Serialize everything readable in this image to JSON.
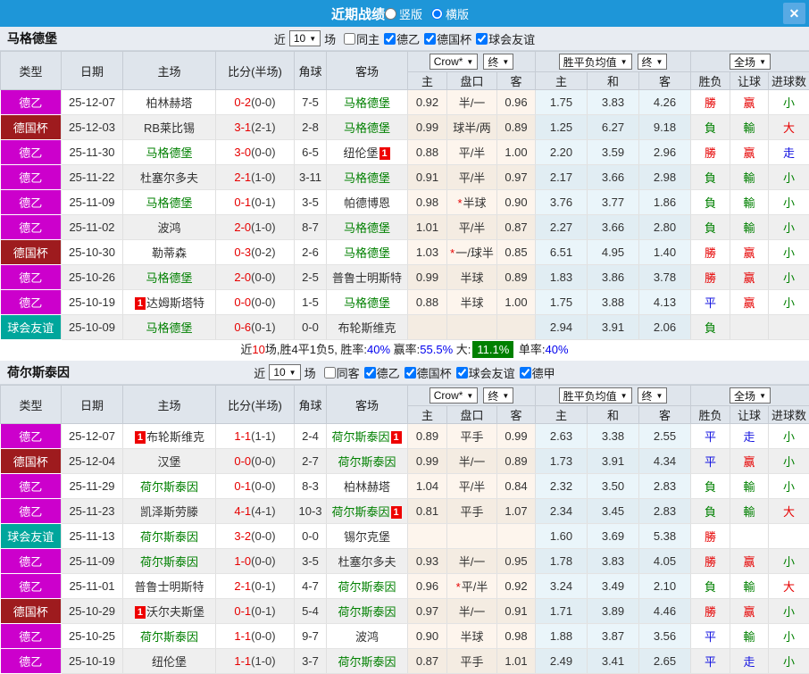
{
  "titlebar": {
    "title": "近期战绩",
    "layout_options": [
      {
        "label": "竖版",
        "checked": false
      },
      {
        "label": "横版",
        "checked": true
      }
    ]
  },
  "icons": {
    "dropdown_arrow": "▼",
    "close": "✕"
  },
  "palette": {
    "titlebar_blue": "#1e96d8",
    "league2_magenta": "#cc00cc",
    "cup_darkred": "#9e1b1e",
    "friendly_teal": "#00a69c",
    "team_green": "#008000",
    "win_red": "#e60000",
    "draw_blue": "#1313e0",
    "rate_blue": "#0000ee",
    "big_rate_badge_bg": "#008000"
  },
  "table_header": {
    "columns": [
      "类型",
      "日期",
      "主场",
      "比分(半场)",
      "角球",
      "客场"
    ],
    "sub_columns": [
      "主",
      "盘口",
      "客",
      "主",
      "和",
      "客",
      "胜负",
      "让球",
      "进球数"
    ],
    "dropdowns": {
      "odds_source": "Crow*",
      "odds_stage": "终",
      "avg_source": "胜平负均值",
      "avg_stage": "终",
      "scope": "全场"
    }
  },
  "sections": [
    {
      "team": "马格德堡",
      "filter": {
        "near_label": "近",
        "count": "10",
        "unit_label": "场",
        "checkboxes": [
          {
            "label": "同主",
            "checked": false
          },
          {
            "label": "德乙",
            "checked": true
          },
          {
            "label": "德国杯",
            "checked": true
          },
          {
            "label": "球会友谊",
            "checked": true
          }
        ]
      },
      "rows": [
        {
          "type": "德乙",
          "style": "lg2",
          "date": "25-12-07",
          "home": "柏林赫塔",
          "home_green": false,
          "home_badge": "",
          "score": "0-2",
          "half": "(0-0)",
          "corner": "7-5",
          "away": "马格德堡",
          "away_green": true,
          "away_badge": "",
          "o1": "0.92",
          "hcp": "半/一",
          "star": false,
          "o2": "0.96",
          "a1": "1.75",
          "a2": "3.83",
          "a3": "4.26",
          "res": "勝",
          "res_c": "r",
          "hres": "赢",
          "hres_c": "r",
          "goal": "小",
          "goal_c": "g"
        },
        {
          "type": "德国杯",
          "style": "cup",
          "date": "25-12-03",
          "home": "RB莱比锡",
          "home_green": false,
          "home_badge": "",
          "score": "3-1",
          "half": "(2-1)",
          "corner": "2-8",
          "away": "马格德堡",
          "away_green": true,
          "away_badge": "",
          "o1": "0.99",
          "hcp": "球半/两",
          "star": false,
          "o2": "0.89",
          "a1": "1.25",
          "a2": "6.27",
          "a3": "9.18",
          "res": "負",
          "res_c": "g",
          "hres": "輸",
          "hres_c": "g",
          "goal": "大",
          "goal_c": "r"
        },
        {
          "type": "德乙",
          "style": "lg2",
          "date": "25-11-30",
          "home": "马格德堡",
          "home_green": true,
          "home_badge": "",
          "score": "3-0",
          "half": "(0-0)",
          "corner": "6-5",
          "away": "纽伦堡",
          "away_green": false,
          "away_badge": "1",
          "o1": "0.88",
          "hcp": "平/半",
          "star": false,
          "o2": "1.00",
          "a1": "2.20",
          "a2": "3.59",
          "a3": "2.96",
          "res": "勝",
          "res_c": "r",
          "hres": "赢",
          "hres_c": "r",
          "goal": "走",
          "goal_c": "b"
        },
        {
          "type": "德乙",
          "style": "lg2",
          "date": "25-11-22",
          "home": "杜塞尔多夫",
          "home_green": false,
          "home_badge": "",
          "score": "2-1",
          "half": "(1-0)",
          "corner": "3-11",
          "away": "马格德堡",
          "away_green": true,
          "away_badge": "",
          "o1": "0.91",
          "hcp": "平/半",
          "star": false,
          "o2": "0.97",
          "a1": "2.17",
          "a2": "3.66",
          "a3": "2.98",
          "res": "負",
          "res_c": "g",
          "hres": "輸",
          "hres_c": "g",
          "goal": "小",
          "goal_c": "g"
        },
        {
          "type": "德乙",
          "style": "lg2",
          "date": "25-11-09",
          "home": "马格德堡",
          "home_green": true,
          "home_badge": "",
          "score": "0-1",
          "half": "(0-1)",
          "corner": "3-5",
          "away": "帕德博恩",
          "away_green": false,
          "away_badge": "",
          "o1": "0.98",
          "hcp": "半球",
          "star": true,
          "o2": "0.90",
          "a1": "3.76",
          "a2": "3.77",
          "a3": "1.86",
          "res": "負",
          "res_c": "g",
          "hres": "輸",
          "hres_c": "g",
          "goal": "小",
          "goal_c": "g"
        },
        {
          "type": "德乙",
          "style": "lg2",
          "date": "25-11-02",
          "home": "波鸿",
          "home_green": false,
          "home_badge": "",
          "score": "2-0",
          "half": "(1-0)",
          "corner": "8-7",
          "away": "马格德堡",
          "away_green": true,
          "away_badge": "",
          "o1": "1.01",
          "hcp": "平/半",
          "star": false,
          "o2": "0.87",
          "a1": "2.27",
          "a2": "3.66",
          "a3": "2.80",
          "res": "負",
          "res_c": "g",
          "hres": "輸",
          "hres_c": "g",
          "goal": "小",
          "goal_c": "g"
        },
        {
          "type": "德国杯",
          "style": "cup",
          "date": "25-10-30",
          "home": "勒蒂森",
          "home_green": false,
          "home_badge": "",
          "score": "0-3",
          "half": "(0-2)",
          "corner": "2-6",
          "away": "马格德堡",
          "away_green": true,
          "away_badge": "",
          "o1": "1.03",
          "hcp": "一/球半",
          "star": true,
          "o2": "0.85",
          "a1": "6.51",
          "a2": "4.95",
          "a3": "1.40",
          "res": "勝",
          "res_c": "r",
          "hres": "赢",
          "hres_c": "r",
          "goal": "小",
          "goal_c": "g"
        },
        {
          "type": "德乙",
          "style": "lg2",
          "date": "25-10-26",
          "home": "马格德堡",
          "home_green": true,
          "home_badge": "",
          "score": "2-0",
          "half": "(0-0)",
          "corner": "2-5",
          "away": "普鲁士明斯特",
          "away_green": false,
          "away_badge": "",
          "o1": "0.99",
          "hcp": "半球",
          "star": false,
          "o2": "0.89",
          "a1": "1.83",
          "a2": "3.86",
          "a3": "3.78",
          "res": "勝",
          "res_c": "r",
          "hres": "赢",
          "hres_c": "r",
          "goal": "小",
          "goal_c": "g"
        },
        {
          "type": "德乙",
          "style": "lg2",
          "date": "25-10-19",
          "home": "达姆斯塔特",
          "home_green": false,
          "home_badge": "1",
          "score": "0-0",
          "half": "(0-0)",
          "corner": "1-5",
          "away": "马格德堡",
          "away_green": true,
          "away_badge": "",
          "o1": "0.88",
          "hcp": "半球",
          "star": false,
          "o2": "1.00",
          "a1": "1.75",
          "a2": "3.88",
          "a3": "4.13",
          "res": "平",
          "res_c": "b",
          "hres": "赢",
          "hres_c": "r",
          "goal": "小",
          "goal_c": "g"
        },
        {
          "type": "球会友谊",
          "style": "fri",
          "date": "25-10-09",
          "home": "马格德堡",
          "home_green": true,
          "home_badge": "",
          "score": "0-6",
          "half": "(0-1)",
          "corner": "0-0",
          "away": "布轮斯维克",
          "away_green": false,
          "away_badge": "",
          "o1": "",
          "hcp": "",
          "star": false,
          "o2": "",
          "a1": "2.94",
          "a2": "3.91",
          "a3": "2.06",
          "res": "負",
          "res_c": "g",
          "hres": "",
          "hres_c": "",
          "goal": "",
          "goal_c": ""
        }
      ],
      "summary": [
        {
          "t": "近"
        },
        {
          "t": "10",
          "c": "red"
        },
        {
          "t": "场,胜4平1负5, 胜率:"
        },
        {
          "t": "40%",
          "c": "blue"
        },
        {
          "t": " 赢率:"
        },
        {
          "t": "55.5%",
          "c": "blue"
        },
        {
          "t": " 大:"
        },
        {
          "t": "11.1%",
          "c": "badge"
        },
        {
          "t": " 单率:"
        },
        {
          "t": "40%",
          "c": "blue"
        }
      ]
    },
    {
      "team": "荷尔斯泰因",
      "filter": {
        "near_label": "近",
        "count": "10",
        "unit_label": "场",
        "checkboxes": [
          {
            "label": "同客",
            "checked": false
          },
          {
            "label": "德乙",
            "checked": true
          },
          {
            "label": "德国杯",
            "checked": true
          },
          {
            "label": "球会友谊",
            "checked": true
          },
          {
            "label": "德甲",
            "checked": true
          }
        ]
      },
      "rows": [
        {
          "type": "德乙",
          "style": "lg2",
          "date": "25-12-07",
          "home": "布轮斯维克",
          "home_green": false,
          "home_badge": "1",
          "score": "1-1",
          "half": "(1-1)",
          "corner": "2-4",
          "away": "荷尔斯泰因",
          "away_green": true,
          "away_badge": "1",
          "o1": "0.89",
          "hcp": "平手",
          "star": false,
          "o2": "0.99",
          "a1": "2.63",
          "a2": "3.38",
          "a3": "2.55",
          "res": "平",
          "res_c": "b",
          "hres": "走",
          "hres_c": "b",
          "goal": "小",
          "goal_c": "g"
        },
        {
          "type": "德国杯",
          "style": "cup",
          "date": "25-12-04",
          "home": "汉堡",
          "home_green": false,
          "home_badge": "",
          "score": "0-0",
          "half": "(0-0)",
          "corner": "2-7",
          "away": "荷尔斯泰因",
          "away_green": true,
          "away_badge": "",
          "o1": "0.99",
          "hcp": "半/一",
          "star": false,
          "o2": "0.89",
          "a1": "1.73",
          "a2": "3.91",
          "a3": "4.34",
          "res": "平",
          "res_c": "b",
          "hres": "赢",
          "hres_c": "r",
          "goal": "小",
          "goal_c": "g"
        },
        {
          "type": "德乙",
          "style": "lg2",
          "date": "25-11-29",
          "home": "荷尔斯泰因",
          "home_green": true,
          "home_badge": "",
          "score": "0-1",
          "half": "(0-0)",
          "corner": "8-3",
          "away": "柏林赫塔",
          "away_green": false,
          "away_badge": "",
          "o1": "1.04",
          "hcp": "平/半",
          "star": false,
          "o2": "0.84",
          "a1": "2.32",
          "a2": "3.50",
          "a3": "2.83",
          "res": "負",
          "res_c": "g",
          "hres": "輸",
          "hres_c": "g",
          "goal": "小",
          "goal_c": "g"
        },
        {
          "type": "德乙",
          "style": "lg2",
          "date": "25-11-23",
          "home": "凯泽斯劳滕",
          "home_green": false,
          "home_badge": "",
          "score": "4-1",
          "half": "(4-1)",
          "corner": "10-3",
          "away": "荷尔斯泰因",
          "away_green": true,
          "away_badge": "1",
          "o1": "0.81",
          "hcp": "平手",
          "star": false,
          "o2": "1.07",
          "a1": "2.34",
          "a2": "3.45",
          "a3": "2.83",
          "res": "負",
          "res_c": "g",
          "hres": "輸",
          "hres_c": "g",
          "goal": "大",
          "goal_c": "r"
        },
        {
          "type": "球会友谊",
          "style": "fri",
          "date": "25-11-13",
          "home": "荷尔斯泰因",
          "home_green": true,
          "home_badge": "",
          "score": "3-2",
          "half": "(0-0)",
          "corner": "0-0",
          "away": "锡尔克堡",
          "away_green": false,
          "away_badge": "",
          "o1": "",
          "hcp": "",
          "star": false,
          "o2": "",
          "a1": "1.60",
          "a2": "3.69",
          "a3": "5.38",
          "res": "勝",
          "res_c": "r",
          "hres": "",
          "hres_c": "",
          "goal": "",
          "goal_c": ""
        },
        {
          "type": "德乙",
          "style": "lg2",
          "date": "25-11-09",
          "home": "荷尔斯泰因",
          "home_green": true,
          "home_badge": "",
          "score": "1-0",
          "half": "(0-0)",
          "corner": "3-5",
          "away": "杜塞尔多夫",
          "away_green": false,
          "away_badge": "",
          "o1": "0.93",
          "hcp": "半/一",
          "star": false,
          "o2": "0.95",
          "a1": "1.78",
          "a2": "3.83",
          "a3": "4.05",
          "res": "勝",
          "res_c": "r",
          "hres": "赢",
          "hres_c": "r",
          "goal": "小",
          "goal_c": "g"
        },
        {
          "type": "德乙",
          "style": "lg2",
          "date": "25-11-01",
          "home": "普鲁士明斯特",
          "home_green": false,
          "home_badge": "",
          "score": "2-1",
          "half": "(0-1)",
          "corner": "4-7",
          "away": "荷尔斯泰因",
          "away_green": true,
          "away_badge": "",
          "o1": "0.96",
          "hcp": "平/半",
          "star": true,
          "o2": "0.92",
          "a1": "3.24",
          "a2": "3.49",
          "a3": "2.10",
          "res": "負",
          "res_c": "g",
          "hres": "輸",
          "hres_c": "g",
          "goal": "大",
          "goal_c": "r"
        },
        {
          "type": "德国杯",
          "style": "cup",
          "date": "25-10-29",
          "home": "沃尔夫斯堡",
          "home_green": false,
          "home_badge": "1",
          "score": "0-1",
          "half": "(0-1)",
          "corner": "5-4",
          "away": "荷尔斯泰因",
          "away_green": true,
          "away_badge": "",
          "o1": "0.97",
          "hcp": "半/一",
          "star": false,
          "o2": "0.91",
          "a1": "1.71",
          "a2": "3.89",
          "a3": "4.46",
          "res": "勝",
          "res_c": "r",
          "hres": "赢",
          "hres_c": "r",
          "goal": "小",
          "goal_c": "g"
        },
        {
          "type": "德乙",
          "style": "lg2",
          "date": "25-10-25",
          "home": "荷尔斯泰因",
          "home_green": true,
          "home_badge": "",
          "score": "1-1",
          "half": "(0-0)",
          "corner": "9-7",
          "away": "波鸿",
          "away_green": false,
          "away_badge": "",
          "o1": "0.90",
          "hcp": "半球",
          "star": false,
          "o2": "0.98",
          "a1": "1.88",
          "a2": "3.87",
          "a3": "3.56",
          "res": "平",
          "res_c": "b",
          "hres": "輸",
          "hres_c": "g",
          "goal": "小",
          "goal_c": "g"
        },
        {
          "type": "德乙",
          "style": "lg2",
          "date": "25-10-19",
          "home": "纽伦堡",
          "home_green": false,
          "home_badge": "",
          "score": "1-1",
          "half": "(1-0)",
          "corner": "3-7",
          "away": "荷尔斯泰因",
          "away_green": true,
          "away_badge": "",
          "o1": "0.87",
          "hcp": "平手",
          "star": false,
          "o2": "1.01",
          "a1": "2.49",
          "a2": "3.41",
          "a3": "2.65",
          "res": "平",
          "res_c": "b",
          "hres": "走",
          "hres_c": "b",
          "goal": "小",
          "goal_c": "g"
        }
      ]
    }
  ]
}
